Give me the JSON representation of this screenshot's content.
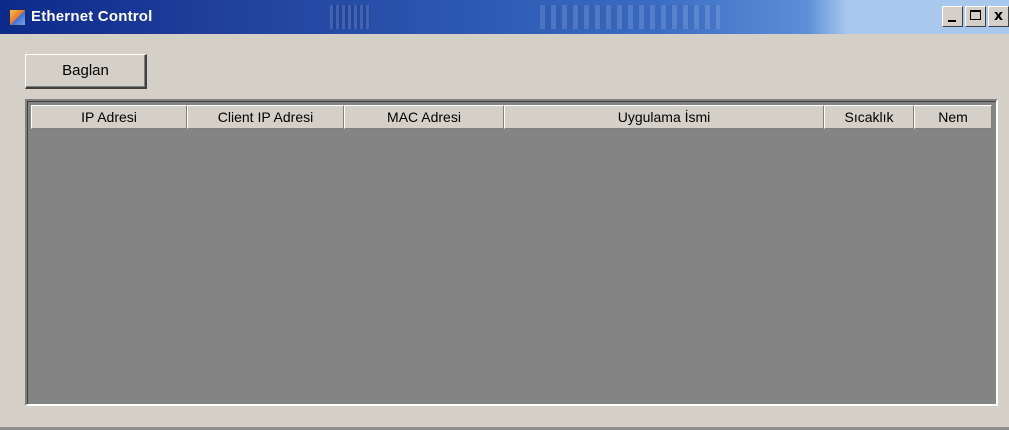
{
  "window": {
    "title": "Ethernet Control",
    "buttons": {
      "minimize": "minimize",
      "maximize": "maximize",
      "close": "x"
    }
  },
  "toolbar": {
    "connect_label": "Baglan"
  },
  "table": {
    "columns": [
      {
        "label": "IP Adresi"
      },
      {
        "label": "Client IP Adresi"
      },
      {
        "label": "MAC Adresi"
      },
      {
        "label": "Uygulama İsmi"
      },
      {
        "label": "Sıcaklık"
      },
      {
        "label": "Nem"
      }
    ],
    "rows": []
  }
}
